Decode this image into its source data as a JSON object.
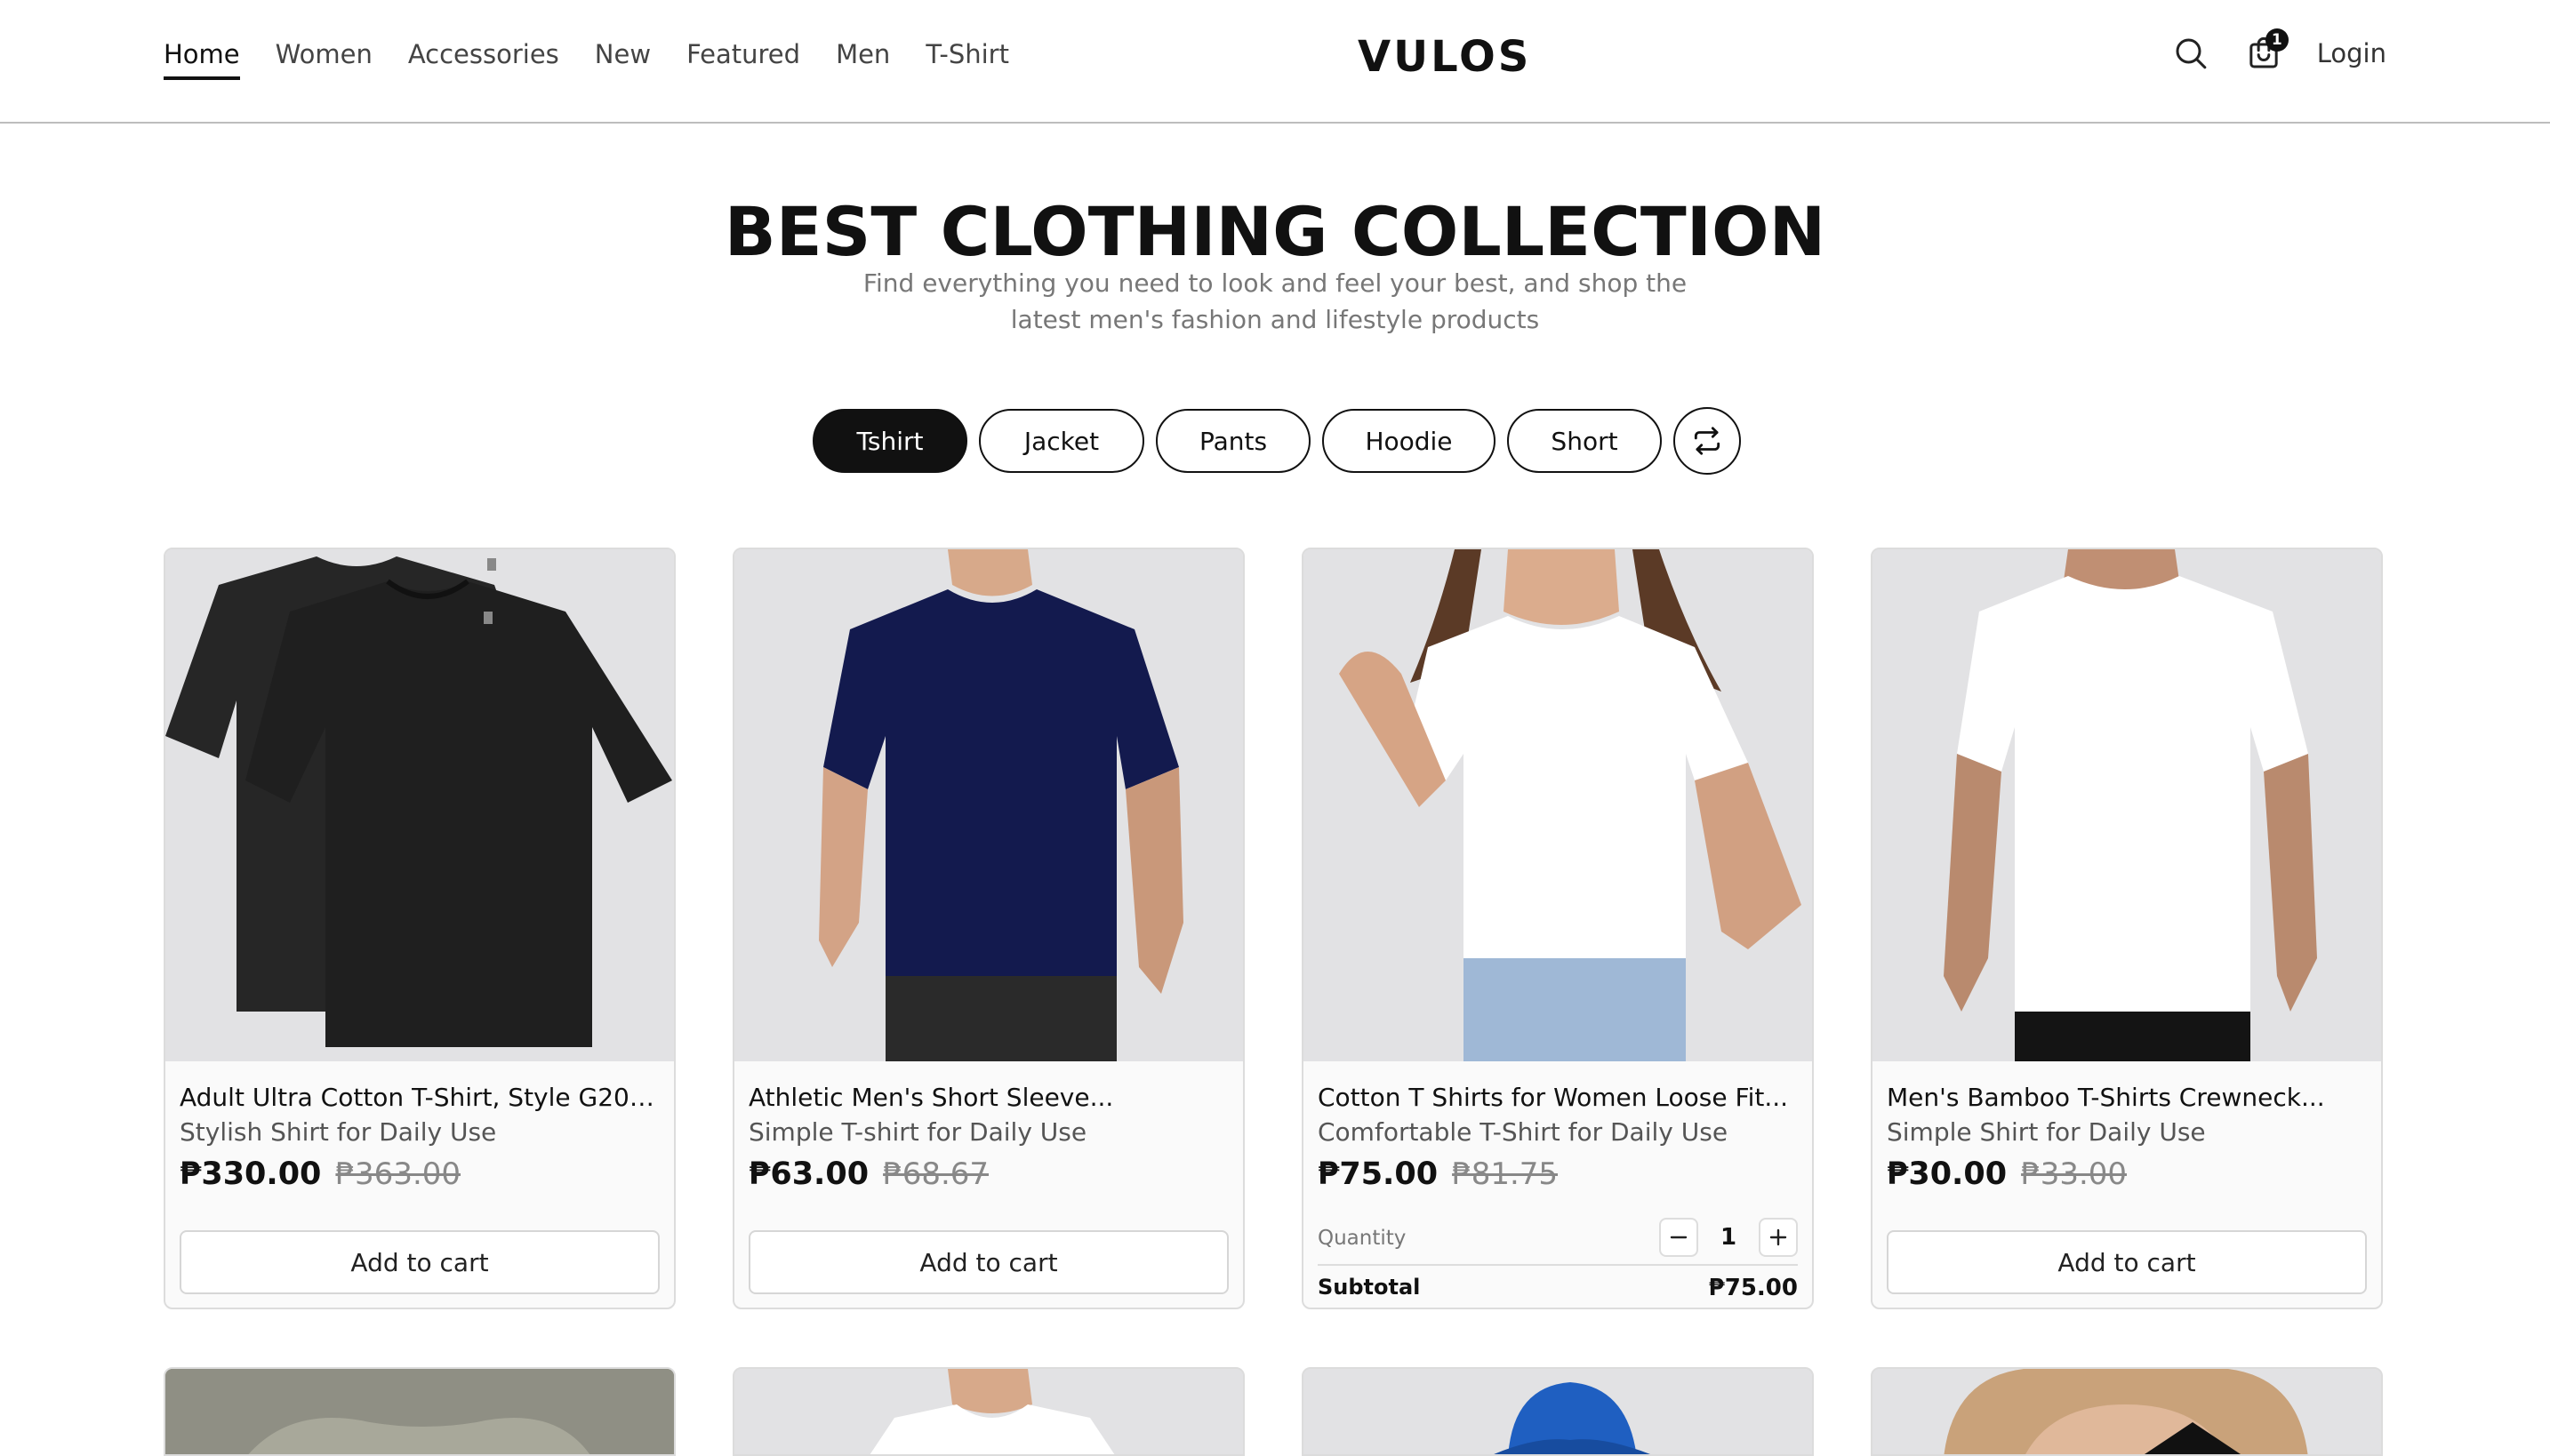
{
  "nav": {
    "items": [
      "Home",
      "Women",
      "Accessories",
      "New",
      "Featured",
      "Men",
      "T-Shirt"
    ],
    "active": "Home"
  },
  "brand": {
    "logo": "VULOS"
  },
  "header": {
    "cart_count": "1",
    "login_label": "Login"
  },
  "hero": {
    "title": "BEST CLOTHING COLLECTION",
    "subtitle": "Find everything you need to look and feel your best, and shop the latest men's fashion and lifestyle products"
  },
  "filters": {
    "items": [
      "Tshirt",
      "Jacket",
      "Pants",
      "Hoodie",
      "Short"
    ],
    "active": "Tshirt",
    "shuffle_icon": "shuffle-icon"
  },
  "products": [
    {
      "title": "Adult Ultra Cotton T-Shirt, Style G2000,...",
      "subtitle": "Stylish Shirt for Daily Use",
      "price": "₱330.00",
      "old_price": "₱363.00",
      "button": "Add to cart",
      "image": "black-tshirts-image"
    },
    {
      "title": "Athletic Men's Short Sleeve...",
      "subtitle": "Simple T-shirt for Daily Use",
      "price": "₱63.00",
      "old_price": "₱68.67",
      "button": "Add to cart",
      "image": "navy-tshirt-man-image"
    },
    {
      "title": "Cotton T Shirts for Women Loose Fit...",
      "subtitle": "Comfortable T-Shirt for Daily Use",
      "price": "₱75.00",
      "old_price": "₱81.75",
      "quantity_label": "Quantity",
      "quantity": "1",
      "subtotal_label": "Subtotal",
      "subtotal": "₱75.00",
      "image": "white-tshirt-woman-image"
    },
    {
      "title": "Men's Bamboo T-Shirts Crewneck...",
      "subtitle": "Simple Shirt for Daily Use",
      "price": "₱30.00",
      "old_price": "₱33.00",
      "button": "Add to cart",
      "image": "white-tshirt-man-image"
    }
  ],
  "colors": {
    "primary": "#111111",
    "muted": "#777777",
    "card_bg": "#fafafa",
    "image_bg": "#e2e2e4"
  }
}
